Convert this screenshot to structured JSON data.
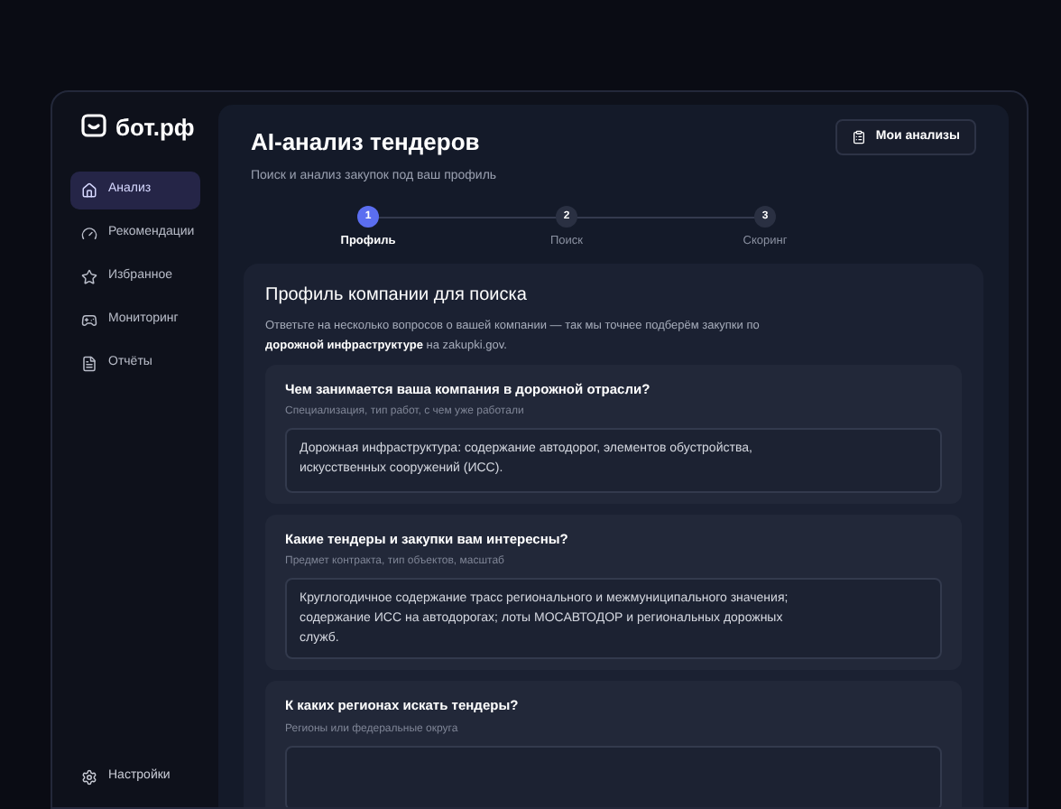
{
  "logo": {
    "text": "бот.рф"
  },
  "sidebar": {
    "items": [
      {
        "label": "Анализ",
        "kind": "home",
        "selected": true
      },
      {
        "label": "Рекомендации",
        "kind": "gauge",
        "selected": false
      },
      {
        "label": "Избранное",
        "kind": "star",
        "selected": false
      },
      {
        "label": "Мониторинг",
        "kind": "monitor",
        "selected": false
      },
      {
        "label": "Отчёты",
        "kind": "file",
        "selected": false
      }
    ],
    "footer": {
      "label": "Настройки",
      "kind": "settings"
    }
  },
  "header": {
    "title": "AI-анализ тендеров",
    "subtitle": "Поиск и анализ закупок под ваш профиль",
    "button": "Мои анализы"
  },
  "steps": [
    {
      "number": "1",
      "label": "Профиль",
      "selected": true
    },
    {
      "number": "2",
      "label": "Поиск",
      "selected": false
    },
    {
      "number": "3",
      "label": "Скоринг",
      "selected": false
    }
  ],
  "form": {
    "title": "Профиль компании для поиска",
    "description": "Ответьте на несколько вопросов о вашей компании — так мы точнее подберём закупки по **дорожной инфраструктуре** на zakupki.gov.",
    "questions": [
      {
        "question": "Чем занимается ваша компания в дорожной отрасли?",
        "hint": "Специализация, тип работ, с чем уже работали",
        "value": "Дорожная инфраструктура: содержание автодорог, элементов обустройства, искусственных сооружений (ИСС)."
      },
      {
        "question": "Какие тендеры и закупки вам интересны?",
        "hint": "Предмет контракта, тип объектов, масштаб",
        "value": "Круглогодичное содержание трасс регионального и межмуниципального значения; содержание ИСС на автодорогах; лоты МОСАВТОДОР и региональных дорожных служб."
      },
      {
        "question": "К каких регионах искать тендеры?",
        "hint": "Регионы или федеральные округа"
      }
    ]
  }
}
